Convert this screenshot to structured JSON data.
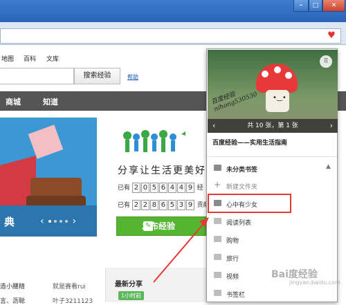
{
  "window": {
    "min_label": "–",
    "max_label": "□",
    "close_label": "✕"
  },
  "top_nav": {
    "items": [
      "地图",
      "百科",
      "文库"
    ]
  },
  "search": {
    "button_label": "搜索经验",
    "help_label": "帮助"
  },
  "main_nav": {
    "items": [
      "商城",
      "知道"
    ]
  },
  "banner": {
    "title": "典"
  },
  "slogan": "分享让生活更美好",
  "counters": [
    {
      "prefix": "已有",
      "digits": [
        "2",
        "0",
        "5",
        "6",
        "4",
        "4",
        "9"
      ],
      "suffix": "经"
    },
    {
      "prefix": "已有",
      "digits": [
        "2",
        "2",
        "8",
        "6",
        "5",
        "3",
        "9"
      ],
      "suffix": "贡献"
    }
  ],
  "publish": {
    "icon": "pen-icon",
    "label": "发布经验"
  },
  "bottom_left": {
    "row1_a": "造小腰精",
    "row1_b": "就是赛看rui",
    "row2_a": "言、沥聪",
    "row2_b": "叶子3211123"
  },
  "share": {
    "title": "最新分享",
    "time": "1小时前"
  },
  "popup": {
    "photo_caption_line1": "百度经验",
    "photo_caption_line2": "nihong530530",
    "image_counter": "共 10 张，第 1 张",
    "title": "百度经验——实用生活指南",
    "folders": [
      {
        "label": "未分类书签",
        "style": "bold",
        "icon": "folder-icon",
        "expandable": true
      },
      {
        "label": "新建文件夹",
        "style": "gray",
        "icon": "plus-icon"
      },
      {
        "label": "心中有少女",
        "style": "normal",
        "icon": "folder-icon"
      },
      {
        "label": "阅读列表",
        "style": "normal",
        "icon": "folder-icon"
      },
      {
        "label": "购物",
        "style": "normal",
        "icon": "folder-icon"
      },
      {
        "label": "旅行",
        "style": "normal",
        "icon": "folder-icon"
      },
      {
        "label": "视频",
        "style": "normal",
        "icon": "folder-icon"
      },
      {
        "label": "书签栏",
        "style": "normal",
        "icon": "folder-icon"
      }
    ]
  },
  "watermark": {
    "main": "Bai度经验",
    "sub": "jingyan.baidu.com"
  },
  "colors": {
    "accent_red": "#e53935",
    "publish_green": "#55b531",
    "heart": "#e23434"
  }
}
